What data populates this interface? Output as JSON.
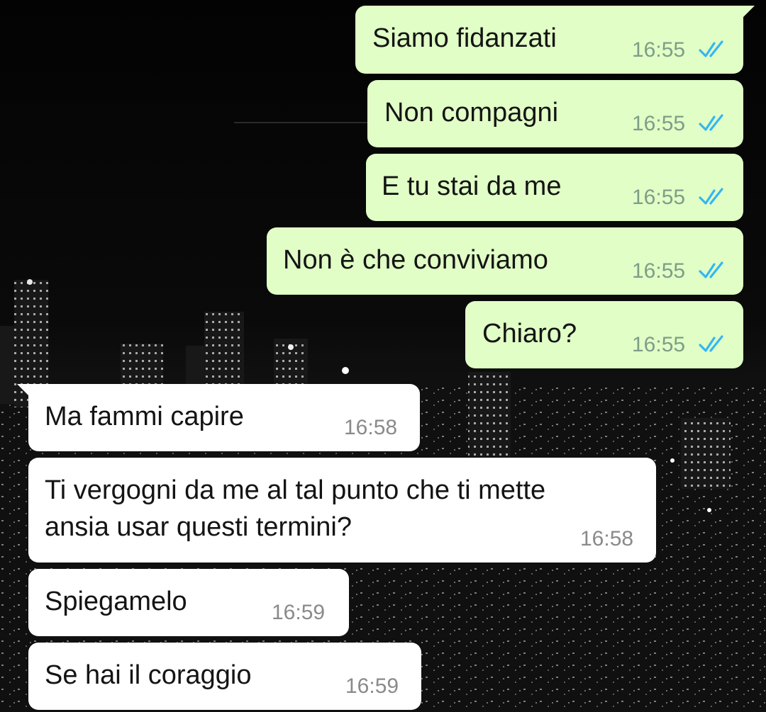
{
  "chat": {
    "messages": [
      {
        "text": "Siamo fidanzati",
        "time": "16:55",
        "status": "read"
      },
      {
        "text": "Non compagni",
        "time": "16:55",
        "status": "read"
      },
      {
        "text": "E tu stai da me",
        "time": "16:55",
        "status": "read"
      },
      {
        "text": "Non è che conviviamo",
        "time": "16:55",
        "status": "read"
      },
      {
        "text": "Chiaro?",
        "time": "16:55",
        "status": "read"
      },
      {
        "text": "Ma fammi capire",
        "time": "16:58"
      },
      {
        "text_line1": "Ti vergogni da me al tal punto che ti mette",
        "text_line2": "ansia usar questi termini?",
        "time": "16:58"
      },
      {
        "text": "Spiegamelo",
        "time": "16:59"
      },
      {
        "text": "Se hai il coraggio",
        "time": "16:59"
      }
    ]
  },
  "colors": {
    "outgoing_bubble": "#e1fec6",
    "incoming_bubble": "#ffffff",
    "read_ticks": "#34b7f1",
    "background": "#060606"
  },
  "icons": {
    "read_receipt": "double-check-icon",
    "wallpaper": "night-city-skyline-wallpaper"
  }
}
